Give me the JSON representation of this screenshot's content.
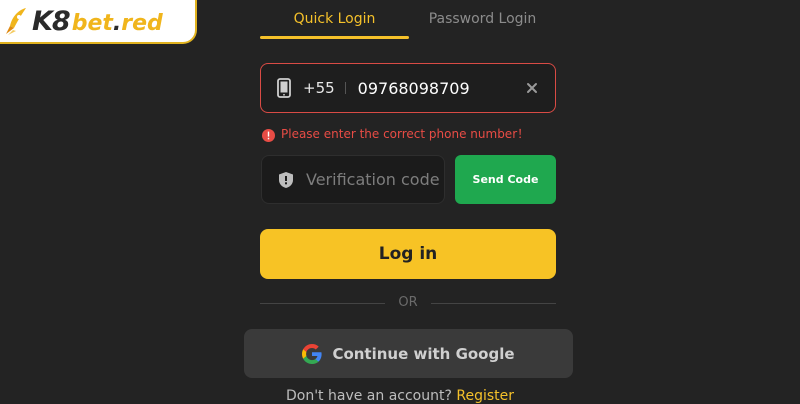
{
  "brand": {
    "logo_main": "K8",
    "logo_suffix": "bet",
    "logo_dot": ".",
    "logo_tld": "red",
    "accent_color": "#f5c12a",
    "icon": "rocket-icon"
  },
  "tabs": [
    {
      "label": "Quick Login",
      "active": true
    },
    {
      "label": "Password Login",
      "active": false
    }
  ],
  "phone": {
    "icon": "phone-icon",
    "country_code": "+55",
    "value": "09768098709",
    "clear_icon": "close-icon"
  },
  "error": {
    "icon": "error-icon",
    "message": "Please enter the correct phone number！",
    "color": "#e84c45"
  },
  "verification": {
    "icon": "shield-icon",
    "placeholder": "Verification code",
    "send_label": "Send Code",
    "send_color": "#1fa84f"
  },
  "login": {
    "label": "Log in",
    "color": "#f7c325"
  },
  "divider": {
    "label": "OR"
  },
  "google": {
    "icon": "google-icon",
    "label": "Continue with Google"
  },
  "register": {
    "prompt": "Don't have an account? ",
    "link": "Register"
  }
}
